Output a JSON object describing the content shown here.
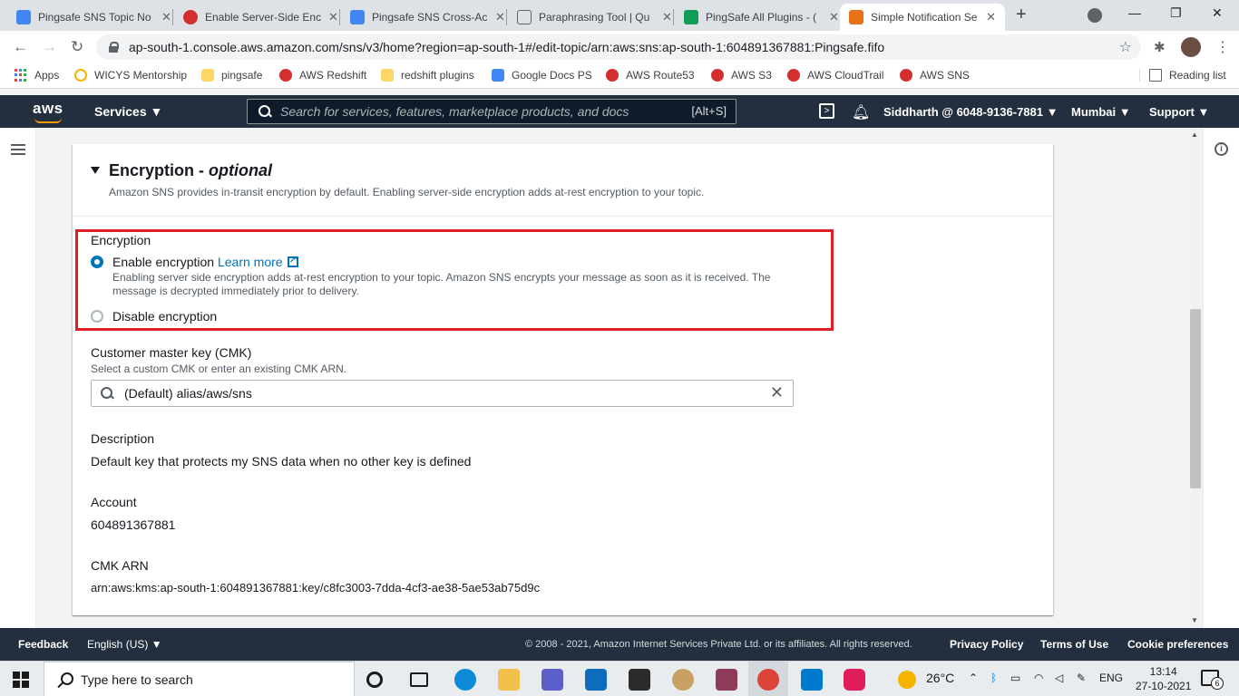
{
  "browser": {
    "tabs": [
      {
        "title": "Pingsafe SNS Topic No",
        "active": false
      },
      {
        "title": "Enable Server-Side Enc",
        "active": false
      },
      {
        "title": "Pingsafe SNS Cross-Ac",
        "active": false
      },
      {
        "title": "Paraphrasing Tool | Qu",
        "active": false
      },
      {
        "title": "PingSafe All Plugins - (",
        "active": false
      },
      {
        "title": "Simple Notification Se",
        "active": true
      }
    ],
    "url": "ap-south-1.console.aws.amazon.com/sns/v3/home?region=ap-south-1#/edit-topic/arn:aws:sns:ap-south-1:604891367881:Pingsafe.fifo",
    "bookmarks": [
      {
        "label": "Apps",
        "icon": "apps-grid-icon"
      },
      {
        "label": "WICYS Mentorship",
        "icon": "hand-icon"
      },
      {
        "label": "pingsafe",
        "icon": "folder-icon"
      },
      {
        "label": "AWS Redshift",
        "icon": "red-ball-icon"
      },
      {
        "label": "redshift plugins",
        "icon": "folder-icon"
      },
      {
        "label": "Google Docs PS",
        "icon": "docs-icon"
      },
      {
        "label": "AWS Route53",
        "icon": "red-ball-icon"
      },
      {
        "label": "AWS S3",
        "icon": "red-ball-icon"
      },
      {
        "label": "AWS CloudTrail",
        "icon": "red-ball-icon"
      },
      {
        "label": "AWS SNS",
        "icon": "red-ball-icon"
      }
    ],
    "reading_list": "Reading list"
  },
  "aws_nav": {
    "logo": "aws",
    "services": "Services",
    "search_placeholder": "Search for services, features, marketplace products, and docs",
    "search_shortcut": "[Alt+S]",
    "account": "Siddharth @ 6048-9136-7881",
    "region": "Mumbai",
    "support": "Support"
  },
  "panel": {
    "title": "Encryption -",
    "title_optional": "optional",
    "description": "Amazon SNS provides in-transit encryption by default. Enabling server-side encryption adds at-rest encryption to your topic."
  },
  "encryption": {
    "label": "Encryption",
    "enable_label": "Enable encryption",
    "learn_more": "Learn more",
    "enable_description": "Enabling server side encryption adds at-rest encryption to your topic. Amazon SNS encrypts your message as soon as it is received. The message is decrypted immediately prior to delivery.",
    "disable_label": "Disable encryption",
    "selected": "enable"
  },
  "cmk": {
    "label": "Customer master key (CMK)",
    "sublabel": "Select a custom CMK or enter an existing CMK ARN.",
    "value": "(Default) alias/aws/sns"
  },
  "details": {
    "description_label": "Description",
    "description_value": "Default key that protects my SNS data when no other key is defined",
    "account_label": "Account",
    "account_value": "604891367881",
    "arn_label": "CMK ARN",
    "arn_value": "arn:aws:kms:ap-south-1:604891367881:key/c8fc3003-7dda-4cf3-ae38-5ae53ab75d9c"
  },
  "footer": {
    "feedback": "Feedback",
    "language": "English (US)",
    "copyright": "© 2008 - 2021, Amazon Internet Services Private Ltd. or its affiliates. All rights reserved.",
    "privacy": "Privacy Policy",
    "terms": "Terms of Use",
    "cookies": "Cookie preferences"
  },
  "taskbar": {
    "search_placeholder": "Type here to search",
    "weather": "26°C",
    "language": "ENG",
    "time": "13:14",
    "date": "27-10-2021",
    "notification_count": "6"
  },
  "colors": {
    "aws_nav": "#232f3e",
    "aws_orange": "#ff9900",
    "link_blue": "#0073bb",
    "highlight_red": "#e01e26"
  }
}
